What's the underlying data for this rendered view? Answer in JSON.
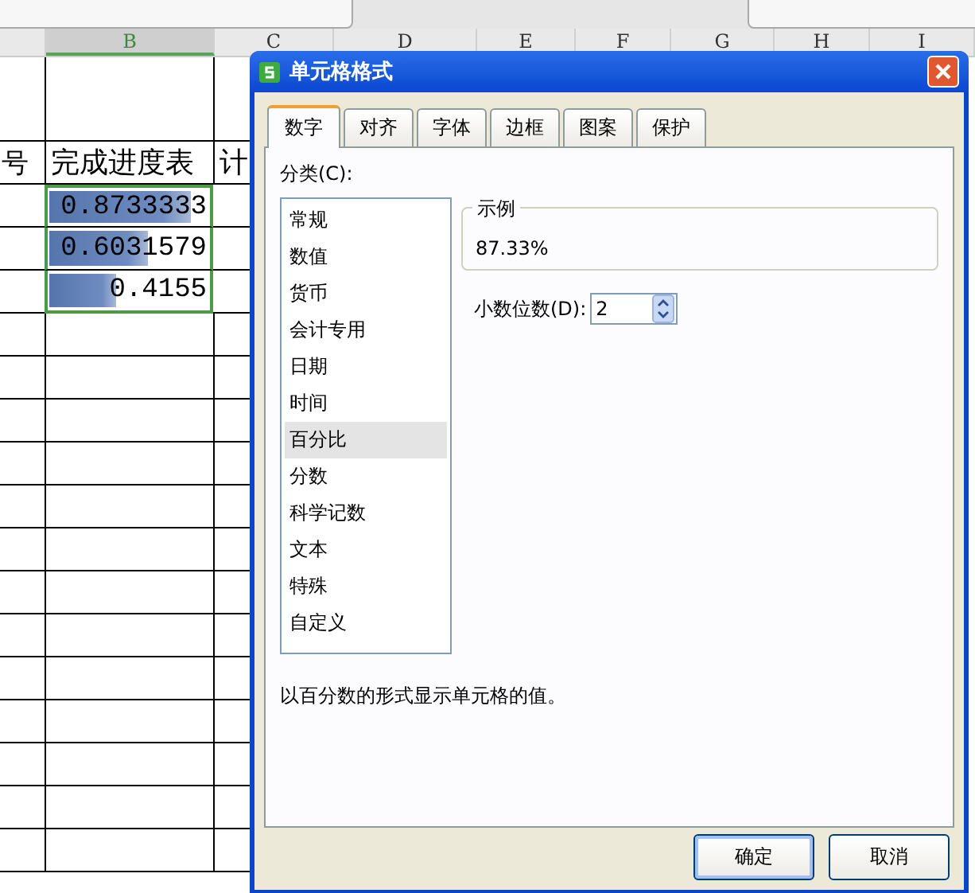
{
  "sheet": {
    "columns": [
      {
        "selected": false
      },
      {
        "label": "B",
        "selected": true
      },
      {
        "label": "C",
        "selected": false
      },
      {
        "label": "D",
        "selected": false
      },
      {
        "label": "E",
        "selected": false
      },
      {
        "label": "F",
        "selected": false
      },
      {
        "label": "G",
        "selected": false
      },
      {
        "label": "H",
        "selected": false
      },
      {
        "label": "I",
        "selected": false
      }
    ],
    "rows": [
      {
        "cells": [
          {
            "text": "号",
            "selected": false
          },
          {
            "text": "完成进度表",
            "selected": false
          },
          {
            "text": "计",
            "selected": false
          }
        ]
      },
      {
        "cells": [
          {
            "selected": false
          },
          {
            "text": "0.8733333",
            "level": 0.8733,
            "selected": true
          },
          {
            "selected": false
          }
        ]
      },
      {
        "cells": [
          {
            "selected": false
          },
          {
            "text": "0.6031579",
            "level": 0.6032,
            "selected": true
          },
          {
            "selected": false
          }
        ]
      },
      {
        "cells": [
          {
            "selected": false
          },
          {
            "text": "0.4155",
            "level": 0.4155,
            "selected": true
          },
          {
            "selected": false
          }
        ]
      }
    ]
  },
  "dialog": {
    "title": "单元格格式",
    "tabs": [
      {
        "label": "数字",
        "selected": true
      },
      {
        "label": "对齐",
        "selected": false
      },
      {
        "label": "字体",
        "selected": false
      },
      {
        "label": "边框",
        "selected": false
      },
      {
        "label": "图案",
        "selected": false
      },
      {
        "label": "保护",
        "selected": false
      }
    ],
    "category_label": "分类(C):",
    "categories": [
      {
        "label": "常规",
        "selected": false
      },
      {
        "label": "数值",
        "selected": false
      },
      {
        "label": "货币",
        "selected": false
      },
      {
        "label": "会计专用",
        "selected": false
      },
      {
        "label": "日期",
        "selected": false
      },
      {
        "label": "时间",
        "selected": false
      },
      {
        "label": "百分比",
        "selected": true
      },
      {
        "label": "分数",
        "selected": false
      },
      {
        "label": "科学记数",
        "selected": false
      },
      {
        "label": "文本",
        "selected": false
      },
      {
        "label": "特殊",
        "selected": false
      },
      {
        "label": "自定义",
        "selected": false
      }
    ],
    "sample": {
      "legend": "示例",
      "value": "87.33%"
    },
    "decimal_places": {
      "label": "小数位数(D):",
      "value": "2"
    },
    "description": "以百分数的形式显示单元格的值。",
    "buttons": [
      {
        "label": "确定",
        "default": true
      },
      {
        "label": "取消",
        "default": false
      }
    ]
  }
}
